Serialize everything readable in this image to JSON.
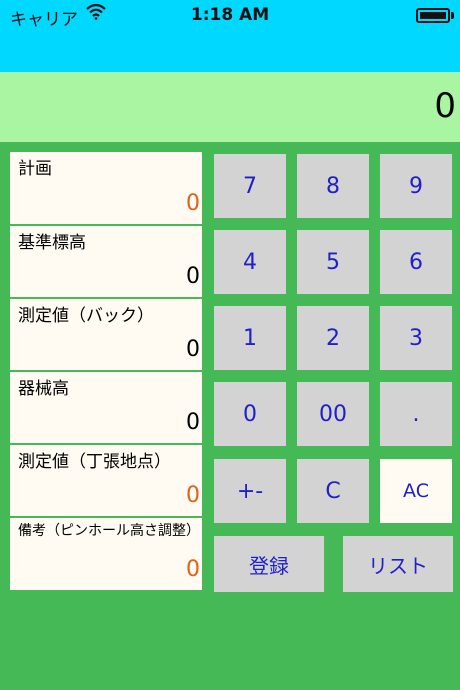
{
  "status_bar": {
    "carrier": "キャリア",
    "time": "1:18 AM"
  },
  "display": {
    "value": "0"
  },
  "fields": [
    {
      "label": "計画",
      "value": "0",
      "value_color": "orange"
    },
    {
      "label": "基準標高",
      "value": "0",
      "value_color": "black"
    },
    {
      "label": "測定値（バック）",
      "value": "0",
      "value_color": "black"
    },
    {
      "label": "器械高",
      "value": "0",
      "value_color": "black"
    },
    {
      "label": "測定値（丁張地点）",
      "value": "0",
      "value_color": "orange"
    },
    {
      "label": "備考（ピンホール高さ調整）",
      "value": "0",
      "value_color": "orange"
    }
  ],
  "keypad": {
    "k7": "7",
    "k8": "8",
    "k9": "9",
    "k4": "4",
    "k5": "5",
    "k6": "6",
    "k1": "1",
    "k2": "2",
    "k3": "3",
    "k0": "0",
    "k00": "00",
    "kdot": ".",
    "kpm": "+-",
    "kc": "C",
    "kac": "AC",
    "register": "登録",
    "list": "リスト"
  },
  "colors": {
    "status_bar_bg": "#00d8ff",
    "display_bg": "#aaf5a2",
    "app_bg": "#45b956",
    "field_bg": "#fffaf2",
    "key_bg": "#d3d3d3",
    "key_text": "#2020c8",
    "value_orange": "#e0611a"
  },
  "icons": [
    "wifi-icon",
    "battery-icon"
  ]
}
